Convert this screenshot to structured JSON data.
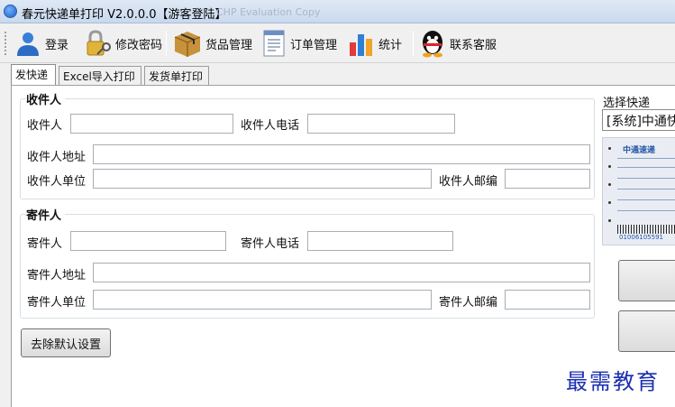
{
  "window": {
    "title": "春元快递单打印 V2.0.0.0【游客登陆】",
    "watermark": "CHP Evaluation Copy"
  },
  "toolbar": {
    "items": [
      {
        "label": "登录",
        "icon": "user-icon"
      },
      {
        "label": "修改密码",
        "icon": "key-lock-icon"
      },
      {
        "label": "货品管理",
        "icon": "package-icon"
      },
      {
        "label": "订单管理",
        "icon": "order-document-icon"
      },
      {
        "label": "统计",
        "icon": "bar-chart-icon"
      },
      {
        "label": "联系客服",
        "icon": "qq-penguin-icon"
      }
    ]
  },
  "tabs": [
    {
      "label": "发快递",
      "active": true
    },
    {
      "label": "Excel导入打印",
      "active": false
    },
    {
      "label": "发货单打印",
      "active": false
    }
  ],
  "recipient": {
    "title": "收件人",
    "name_label": "收件人",
    "phone_label": "收件人电话",
    "address_label": "收件人地址",
    "company_label": "收件人单位",
    "zip_label": "收件人邮编",
    "name_value": "",
    "phone_value": "",
    "address_value": "",
    "company_value": "",
    "zip_value": ""
  },
  "sender": {
    "title": "寄件人",
    "name_label": "寄件人",
    "phone_label": "寄件人电话",
    "address_label": "寄件人地址",
    "company_label": "寄件人单位",
    "zip_label": "寄件人邮编",
    "name_value": "",
    "phone_value": "",
    "address_value": "",
    "company_value": "",
    "zip_value": ""
  },
  "actions": {
    "clear_defaults_label": "去除默认设置"
  },
  "courier": {
    "label": "选择快递",
    "selected": "[系统]中通快递",
    "preview_header": "中通速递",
    "preview_number": "01006105591"
  },
  "brand_text": "最需教育",
  "colors": {
    "brand": "#1a2fb0",
    "group_border": "#d5dfe5"
  }
}
